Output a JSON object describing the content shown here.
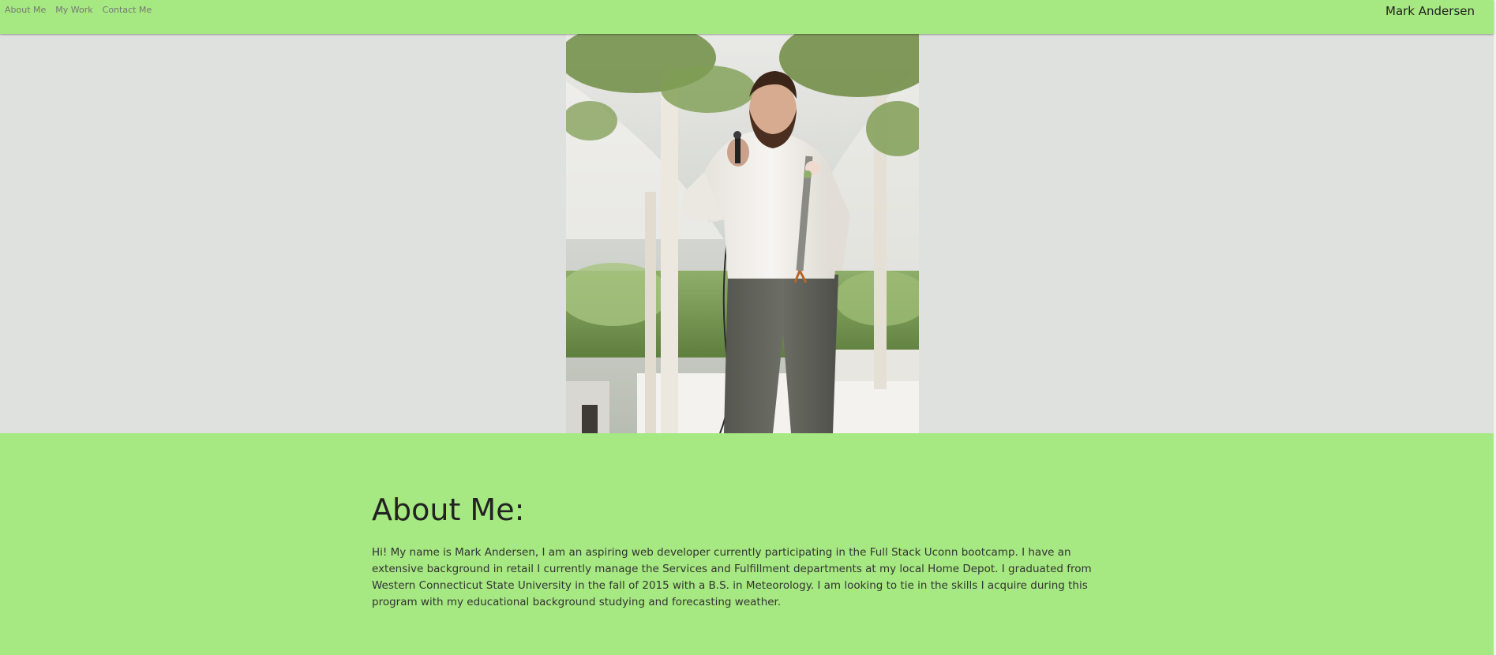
{
  "nav": {
    "links": [
      "About Me",
      "My Work",
      "Contact Me"
    ],
    "brand": "Mark Andersen"
  },
  "hero": {
    "image": "portrait-photo"
  },
  "about": {
    "title": "About Me:",
    "body": "Hi! My name is Mark Andersen, I am an aspiring web developer currently participating in the Full Stack Uconn bootcamp. I have an extensive background in retail I currently manage the Services and Fulfillment departments at my local Home Depot. I graduated from Western Connecticut State University in the fall of 2015 with a B.S. in Meteorology. I am looking to tie in the skills I acquire during this program with my educational background studying and forecasting weather."
  },
  "colors": {
    "navbar": "#a6e881",
    "hero_background": "#dfe1de",
    "about_background": "#a6e881"
  }
}
